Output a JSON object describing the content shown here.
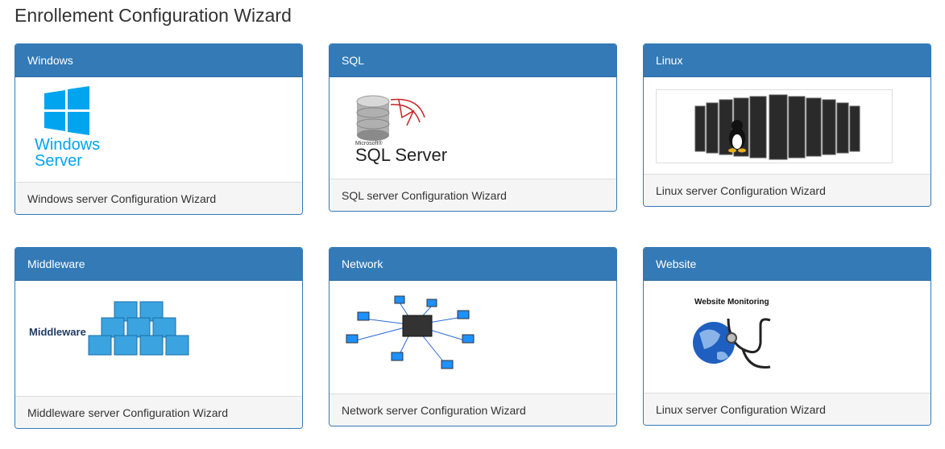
{
  "page": {
    "title": "Enrollement Configuration Wizard"
  },
  "cards": [
    {
      "header": "Windows",
      "footer": "Windows server Configuration Wizard",
      "logo_text_line1": "Windows",
      "logo_text_line2": "Server"
    },
    {
      "header": "SQL",
      "footer": "SQL server Configuration Wizard",
      "logo_small": "Microsoft®",
      "logo_text": "SQL Server"
    },
    {
      "header": "Linux",
      "footer": "Linux server Configuration Wizard"
    },
    {
      "header": "Middleware",
      "footer": "Middleware server Configuration Wizard",
      "logo_text": "Middleware"
    },
    {
      "header": "Network",
      "footer": "Network server Configuration Wizard"
    },
    {
      "header": "Website",
      "footer": "Linux server Configuration Wizard",
      "logo_text": "Website Monitoring"
    }
  ],
  "colors": {
    "panel_primary": "#337ab7",
    "footer_bg": "#f5f5f5",
    "windows_blue": "#00a4ef",
    "cube_blue": "#3aa3e0"
  }
}
